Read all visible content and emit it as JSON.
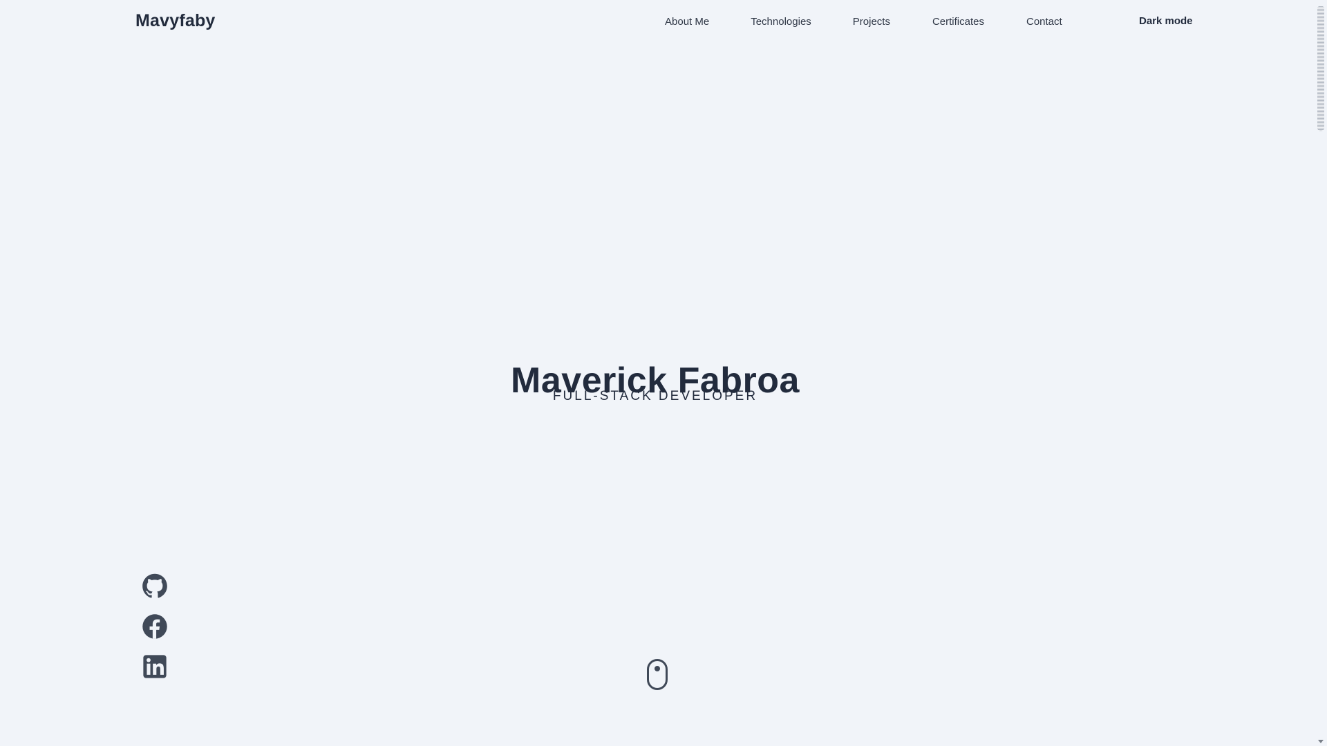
{
  "header": {
    "brand": "Mavyfaby",
    "nav": {
      "about": "About Me",
      "technologies": "Technologies",
      "projects": "Projects",
      "certificates": "Certificates",
      "contact": "Contact"
    },
    "dark_mode": "Dark mode"
  },
  "hero": {
    "title": "Maverick Fabroa",
    "subtitle": "FULL-STACK DEVELOPER"
  },
  "social": {
    "github": "github-icon",
    "facebook": "facebook-icon",
    "linkedin": "linkedin-icon"
  },
  "colors": {
    "background": "#f1f4f9",
    "text": "#222b3d",
    "icon": "#404958"
  }
}
